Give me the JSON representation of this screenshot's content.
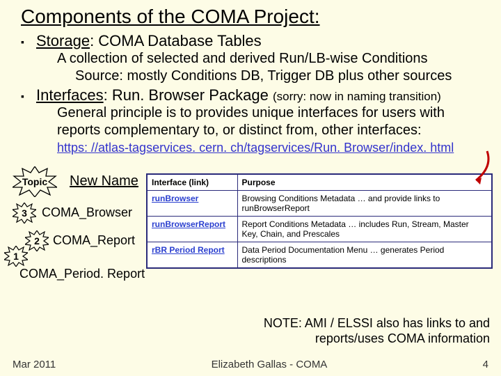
{
  "title": "Components of the COMA Project:",
  "bullets": {
    "storage": {
      "label": "Storage",
      "rest": ": COMA Database Tables",
      "sub1": "A collection of selected and derived Run/LB-wise Conditions",
      "sub2": "Source: mostly Conditions DB, Trigger DB plus other sources"
    },
    "interfaces": {
      "label": "Interfaces",
      "rest": ": Run. Browser Package ",
      "paren": "(sorry: now in naming transition)",
      "sub1": "General principle is to provides unique interfaces for users with reports complementary to, or distinct from, other interfaces:",
      "link": "https: //atlas-tagservices. cern. ch/tagservices/Run. Browser/index. html"
    }
  },
  "bursts": {
    "topic": "Topic",
    "n3": "3",
    "n2": "2",
    "n1": "1"
  },
  "newname_header": "New Name",
  "labels": {
    "browser": "COMA_Browser",
    "report": "COMA_Report",
    "period": "COMA_Period. Report"
  },
  "table": {
    "head": {
      "interface": "Interface (link)",
      "purpose": "Purpose"
    },
    "rows": [
      {
        "link": "runBrowser",
        "purpose": "Browsing Conditions Metadata … and provide links to runBrowserReport"
      },
      {
        "link": "runBrowserReport",
        "purpose": "Report Conditions Metadata … includes Run, Stream, Master Key, Chain, and Prescales"
      },
      {
        "link": "rBR Period Report",
        "purpose": "Data Period Documentation Menu … generates Period descriptions"
      }
    ]
  },
  "note": "NOTE: AMI / ELSSI also has links to and reports/uses COMA information",
  "footer": {
    "date": "Mar 2011",
    "author": "Elizabeth Gallas - COMA",
    "page": "4"
  }
}
